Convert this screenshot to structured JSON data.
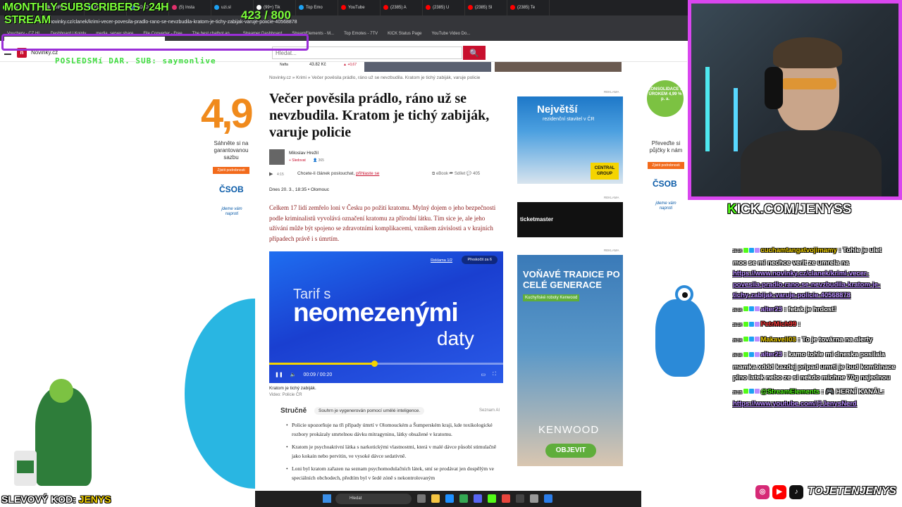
{
  "browser": {
    "tabs": [
      {
        "label": "Kick",
        "color": "#53fc18"
      },
      {
        "label": "BotRi",
        "color": "#888888"
      },
      {
        "label": "KOLO ŠT",
        "color": "#4285f4"
      },
      {
        "label": "KOLO ŠT",
        "color": "#4285f4"
      },
      {
        "label": "(5) Insta",
        "color": "#e1306c"
      },
      {
        "label": "uzi.sl",
        "color": "#1da1f2"
      },
      {
        "label": "(99+) Tik",
        "color": "#ffffff"
      },
      {
        "label": "Top Emo",
        "color": "#1da1f2"
      },
      {
        "label": "YouTube",
        "color": "#ff0000"
      },
      {
        "label": "(2385) A",
        "color": "#ff0000"
      },
      {
        "label": "(2385) U",
        "color": "#ff0000"
      },
      {
        "label": "(2385) Sl",
        "color": "#ff0000"
      },
      {
        "label": "(2385) Te",
        "color": "#ff0000"
      }
    ],
    "url": "novinky.cz/clanek/krimi-vecer-povesila-pradlo-rano-se-nevzbudila-kratom-je-tichy-zabijak-varuje-policie-40568878",
    "bookmarks": [
      "Vouchery - CZ.HL",
      "Dashboard | Koinly",
      "media_server share",
      "File Converter - Free",
      "The best chatbot an...",
      "Streamer Dashboard",
      "StreamElements - M...",
      "Top Emotes - 7TV",
      "KICK Status Page",
      "YouTube Video Do..."
    ]
  },
  "stream": {
    "subs_title_line1": "MONTHLY SUBSCRIBERS / 24H",
    "subs_title_line2": "STREAM",
    "subs_count": "423 / 800",
    "subs_progress": 0.53,
    "last_donation": "POSLEDSMí DAR. SUB: saymonlive",
    "kick_url_k": "K",
    "kick_url_rest": "ICK.COM/JENYSS",
    "discount_label": "SLEVOVÝ KOD:",
    "discount_code": "JENYS",
    "social_name": "TOJETENJENYS"
  },
  "site": {
    "logo_badge": "n",
    "logo_text": "Novinky.cz",
    "search_placeholder": "Hledat...",
    "search_icon": "🔍",
    "ticker_name": "Nafta",
    "ticker_value": "43.82 Kč",
    "ticker_change": "▲ +0,67",
    "breadcrumb": "Novinky.cz » Krimi » Večer pověsila prádlo, ráno už se nevzbudila. Kratom je tichý zabiják, varuje policie",
    "title": "Večer pověsila prádlo, ráno už se nevzbudila. Kratom je tichý zabiják, varuje policie",
    "author": "Miloslav Hrežil",
    "follow": "+ Sledovat",
    "followers": "👤 365",
    "listen_time": "4:15",
    "listen_text": "Chcete-li článek poslouchat,",
    "listen_link": "přihlaste se",
    "actions": "⧉ eBook   ➦ Sdílet   💬 405",
    "date": "Dnes 20. 3., 18:35  •  Olomouc",
    "perex": "Celkem 17 lidí zemřelo loni v Česku po požití kratomu. Mylný dojem o jeho bezpečnosti podle kriminalistů vyvolává označení kratomu za přírodní látku. Tím sice je, ale jeho užívání může být spojeno se zdravotními komplikacemi, vznikem závislosti a v krajních případech právě i s úmrtím.",
    "video": {
      "ad_label": "Reklama 1/2",
      "skip_label": "Přeskočit za 6",
      "line1": "Tarif s",
      "line2": "neomezenými",
      "line3": "daty",
      "time": "00:09  /  00:20",
      "progress": 0.45
    },
    "caption": "Kratom je tichý zabiják.",
    "caption_src": "Video: Policie ČR",
    "summary_label": "Stručně",
    "summary_note": "Souhrn je vygenerován pomocí umělé inteligence.",
    "summary_src": "Seznam AI",
    "bullets": [
      "Policie upozorňuje na tři případy úmrtí v Olomouckém a Šumperském kraji, kde toxikologické rozbory prokázaly smrtelnou dávku mitragyninu, látky obsažené v kratomu.",
      "Kratom je psychoaktivní látka s narkotickými vlastnostmi, která v malé dávce působí stimulačně jako kokain nebo pervitin, ve vysoké dávce sedativně.",
      "Loni byl kratom zařazen na seznam psychomodulačních látek, smí se prodávat jen dospělým ve speciálních obchodech, předtím byl v šedé zóně s nekontrolovaným"
    ],
    "ad_label": "REKLAMA",
    "ad1_title": "Největší",
    "ad1_sub": "rezidenční stavitel v ČR",
    "ad1_badge": "CENTRAL GROUP",
    "ad2_title": "ticketmaster",
    "ad3_title": "VOŇAVÉ TRADICE PO CELÉ GENERACE",
    "ad3_sub": "Kuchyňské roboty Kenwood",
    "ad3_brand": "KENWOOD",
    "ad3_button": "OBJEVIT",
    "left_ad_number": "4,9",
    "left_ad_text": "Sáhněte si na garantovanou sazbu",
    "left_ad_btn": "Zjistit podrobnosti",
    "bank": "ČSOB",
    "bank_sub": "jdeme vám naproti",
    "right_ad_circle": "KONSOLIDACE S ÚROKEM 4,99 % p. a.",
    "right_ad_text": "Převeďte si půjčky k nám",
    "right_ad_btn": "Zjistit podrobnosti"
  },
  "chat": [
    {
      "ts": "20:14",
      "user": "cuchamtangatvojimamy",
      "user_color": "#f5d400",
      "text": "Tohle je ulet moc se mi nechce verit ze umrela na",
      "link": "https://www.novinky.cz/clanek/krimi-vecer-povesila-pradlo-rano-se-nevzbudila-kratom-je-tichy-zabijak-varuje-policie-40568878"
    },
    {
      "ts": "20:14",
      "user": "alter23",
      "user_color": "#b98cff",
      "text": "fetak je hrdost!",
      "link": ""
    },
    {
      "ts": "20:14",
      "user": "PetrMich99",
      "user_color": "#ff3a3a",
      "text": "",
      "link": ""
    },
    {
      "ts": "20:14",
      "user": "Makaveli03",
      "user_color": "#f5d400",
      "text": "To je továrna na alerty",
      "link": ""
    },
    {
      "ts": "20:14",
      "user": "alter23",
      "user_color": "#b98cff",
      "text": "kamo tohle mi dneska posilala mamka xddd kazdej pripad umrti je bud kombinace plno latek nebo ze si nekdo michne 70g najednou",
      "link": ""
    },
    {
      "ts": "20:15",
      "user": "@StreamElements",
      "user_color": "#53fc18",
      "text": "🎮 HERNÍ KANÁL:",
      "link": "https://www.youtube.com/@JenysNerd"
    }
  ],
  "taskbar": {
    "search": "Hledat"
  }
}
